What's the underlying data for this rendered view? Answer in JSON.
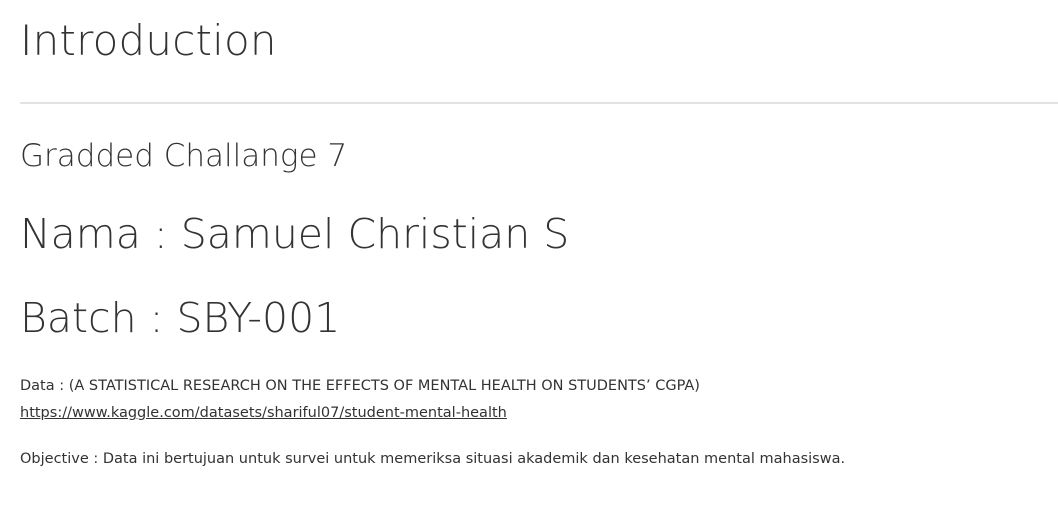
{
  "intro": {
    "title": "Introduction"
  },
  "header": {
    "subtitle": "Gradded Challange 7",
    "nama": "Nama : Samuel Christian S",
    "batch": "Batch : SBY-001"
  },
  "data_section": {
    "text": "Data : (A STATISTICAL RESEARCH ON THE EFFECTS OF MENTAL HEALTH ON STUDENTS’ CGPA)",
    "link_text": "https://www.kaggle.com/datasets/shariful07/student-mental-health"
  },
  "objective": {
    "text": "Objective : Data ini bertujuan untuk survei untuk memeriksa situasi akademik dan kesehatan mental mahasiswa."
  }
}
